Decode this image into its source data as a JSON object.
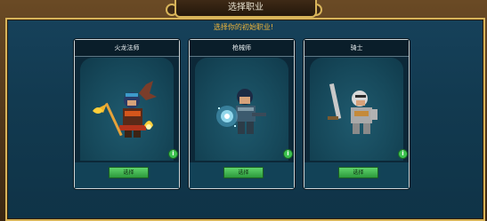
{
  "window": {
    "title": "选择职业",
    "subtitle": "选择你的初始职业!"
  },
  "classes": [
    {
      "name": "火龙法师",
      "button_label": "选择",
      "icon": "fire-mage-character"
    },
    {
      "name": "枪械师",
      "button_label": "选择",
      "icon": "gunslinger-character"
    },
    {
      "name": "骑士",
      "button_label": "选择",
      "icon": "knight-character"
    }
  ],
  "colors": {
    "accent_gold": "#d8b45a",
    "subtitle": "#f0b53a",
    "button_green": "#3cc24f",
    "panel_blue": "#16415a"
  }
}
